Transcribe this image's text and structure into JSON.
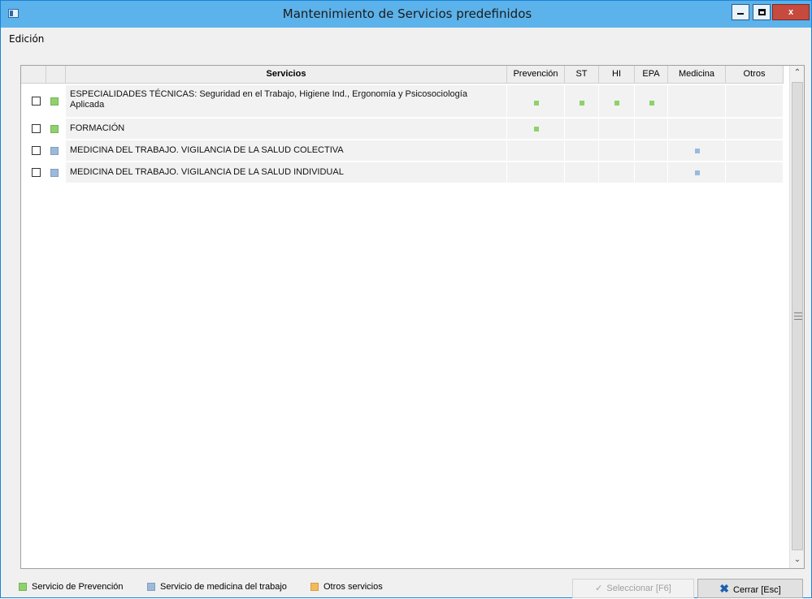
{
  "window": {
    "title": "Mantenimiento de Servicios predefinidos",
    "controls": {
      "minimize": "—",
      "maximize": "□",
      "close": "x"
    }
  },
  "menu": {
    "items": [
      "Edición"
    ]
  },
  "colors": {
    "prevencion": "#8ed26b",
    "medicina": "#9bb9dc",
    "otros": "#f6b95a",
    "titlebar": "#5cb2ea"
  },
  "grid": {
    "columns": [
      "Servicios",
      "Prevención",
      "ST",
      "HI",
      "EPA",
      "Medicina",
      "Otros"
    ],
    "rows": [
      {
        "service": "ESPECIALIDADES TÉCNICAS: Seguridad en el Trabajo, Higiene Ind., Ergonomía y Psicosociología Aplicada",
        "type": "prevencion",
        "marks": {
          "Prevención": true,
          "ST": true,
          "HI": true,
          "EPA": true,
          "Medicina": false,
          "Otros": false
        }
      },
      {
        "service": "FORMACIÓN",
        "type": "prevencion",
        "marks": {
          "Prevención": true,
          "ST": false,
          "HI": false,
          "EPA": false,
          "Medicina": false,
          "Otros": false
        }
      },
      {
        "service": "MEDICINA DEL TRABAJO. VIGILANCIA DE LA SALUD COLECTIVA",
        "type": "medicina",
        "marks": {
          "Prevención": false,
          "ST": false,
          "HI": false,
          "EPA": false,
          "Medicina": true,
          "Otros": false
        }
      },
      {
        "service": "MEDICINA DEL TRABAJO. VIGILANCIA DE LA SALUD INDIVIDUAL",
        "type": "medicina",
        "marks": {
          "Prevención": false,
          "ST": false,
          "HI": false,
          "EPA": false,
          "Medicina": true,
          "Otros": false
        }
      }
    ]
  },
  "legend": [
    {
      "label": "Servicio de Prevención",
      "type": "prevencion"
    },
    {
      "label": "Servicio de medicina del trabajo",
      "type": "medicina"
    },
    {
      "label": "Otros servicios",
      "type": "otros"
    }
  ],
  "buttons": {
    "select": "Seleccionar [F6]",
    "close": "Cerrar [Esc]"
  }
}
